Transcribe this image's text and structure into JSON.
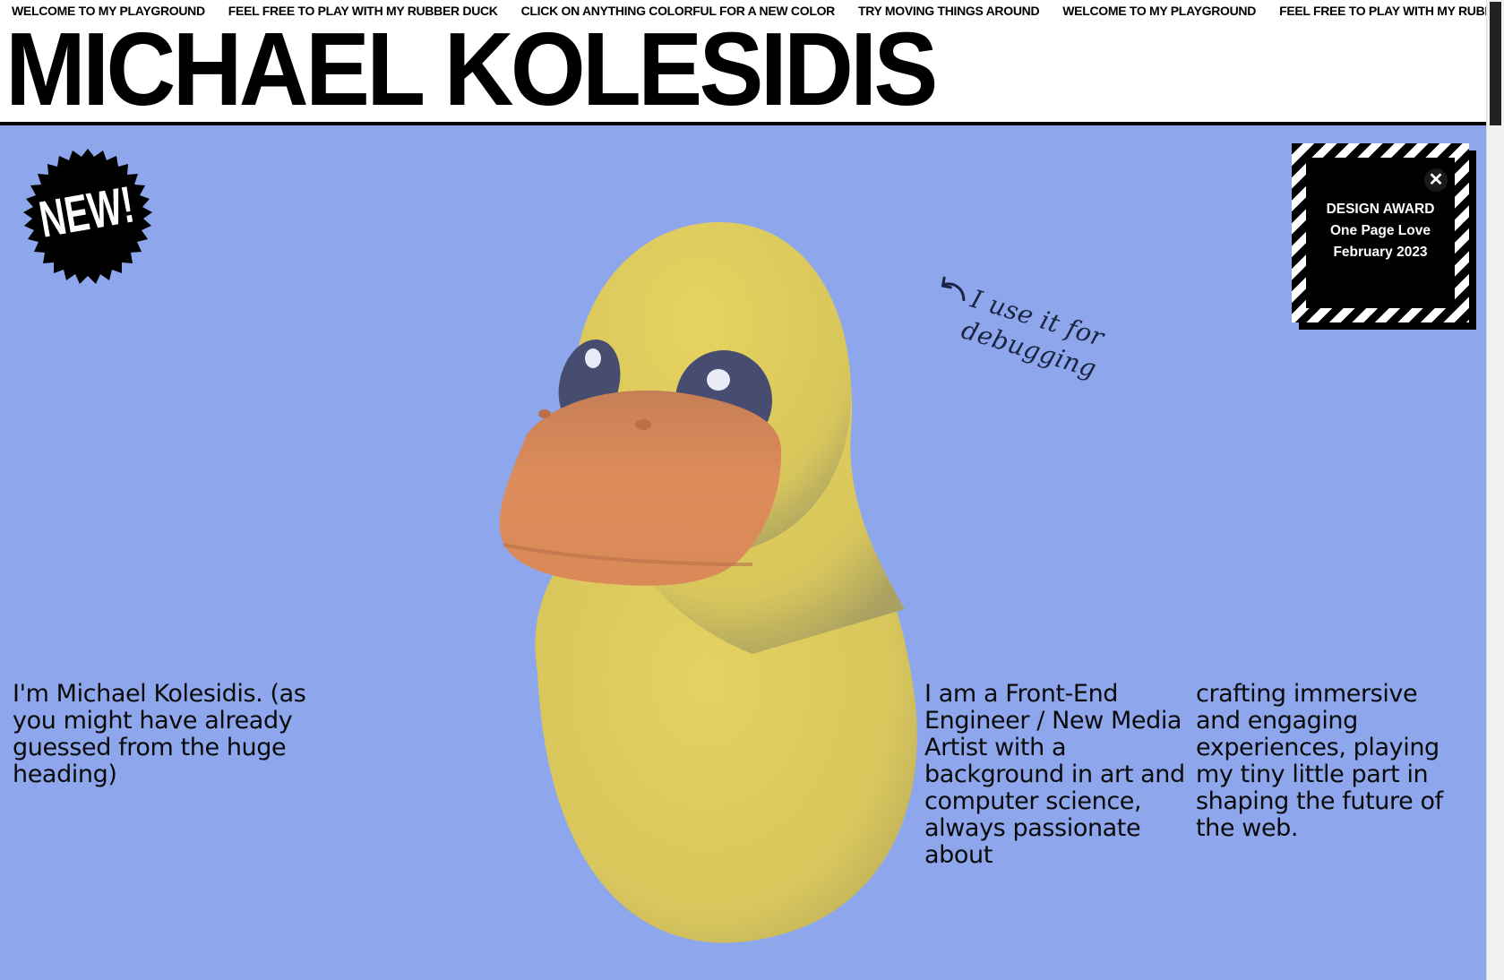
{
  "marquee": {
    "items": [
      "WELCOME TO MY PLAYGROUND",
      "FEEL FREE TO PLAY WITH MY RUBBER DUCK",
      "CLICK ON ANYTHING COLORFUL FOR A NEW COLOR",
      "TRY MOVING THINGS AROUND",
      "WELCOME TO MY PLAYGROUND",
      "FEEL FREE TO PLAY WITH MY RUBBER DUCK"
    ]
  },
  "header": {
    "title": "MICHAEL KOLESIDIS"
  },
  "badge": {
    "label": "NEW!"
  },
  "award": {
    "close_icon": "✕",
    "heading": "DESIGN AWARD",
    "source": "One Page Love",
    "date": "February 2023"
  },
  "note": {
    "text": "I use it for debugging",
    "arrow_icon": "curved-arrow-icon"
  },
  "intro": {
    "left": "I'm Michael Kolesidis. (as you might have already guessed from the huge heading)",
    "middle": "I am a Front-End Engineer / New Media Artist with a background in art and computer science, always passionate about",
    "right": "crafting immersive and engaging experiences, playing my tiny little part in shaping the future of the web."
  },
  "colors": {
    "hero_background": "#8ea7ec",
    "duck_body": "#e0cc5e",
    "duck_beak": "#d88a58",
    "ink": "#000000"
  }
}
